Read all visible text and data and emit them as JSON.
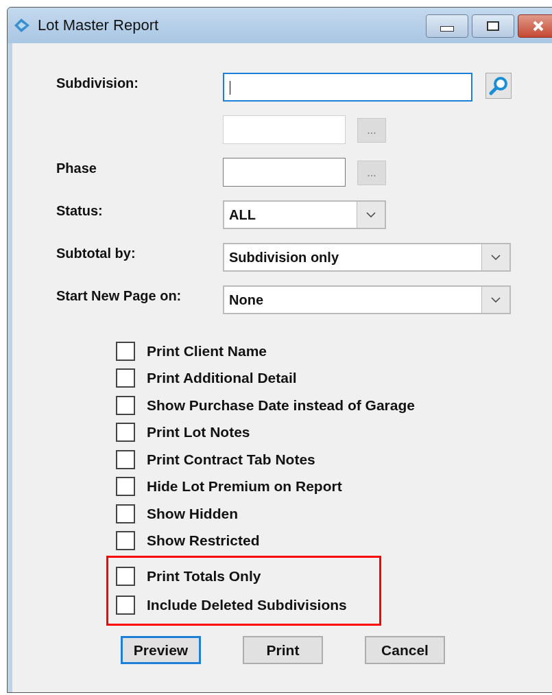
{
  "window": {
    "title": "Lot Master Report"
  },
  "form": [
    {
      "kind": "text",
      "label": "Subdivision:",
      "focused": true,
      "disabled": false,
      "button": {
        "kind": "search"
      }
    },
    {
      "kind": "text",
      "focused": false,
      "disabled": true,
      "button": {
        "kind": "ellipsis",
        "text": "..."
      }
    },
    {
      "kind": "text",
      "label": "Phase",
      "focused": false,
      "disabled": false,
      "button": {
        "kind": "ellipsis",
        "text": "..."
      }
    },
    {
      "kind": "short_combo",
      "label": "Status:",
      "value": "ALL"
    },
    {
      "kind": "combo",
      "label": "Subtotal by:",
      "value": "Subdivision only"
    },
    {
      "kind": "combo",
      "label": "Start New Page on:",
      "value": "None"
    }
  ],
  "options": [
    {
      "label": "Print Client Name",
      "checked": false
    },
    {
      "label": "Print Additional Detail",
      "checked": false
    },
    {
      "label": "Show Purchase Date instead of Garage",
      "checked": false
    },
    {
      "label": "Print Lot Notes",
      "checked": false
    },
    {
      "label": "Print Contract Tab Notes",
      "checked": false
    },
    {
      "label": "Hide Lot Premium on Report",
      "checked": false
    },
    {
      "label": "Show Hidden",
      "checked": false
    },
    {
      "label": "Show Restricted",
      "checked": false
    }
  ],
  "highlighted_options": [
    {
      "label": "Print Totals Only",
      "checked": false
    },
    {
      "label": "Include Deleted Subdivisions",
      "checked": false
    }
  ],
  "buttons": [
    {
      "label": "Preview",
      "default": true
    },
    {
      "label": "Print",
      "default": false
    },
    {
      "label": "Cancel",
      "default": false
    }
  ]
}
